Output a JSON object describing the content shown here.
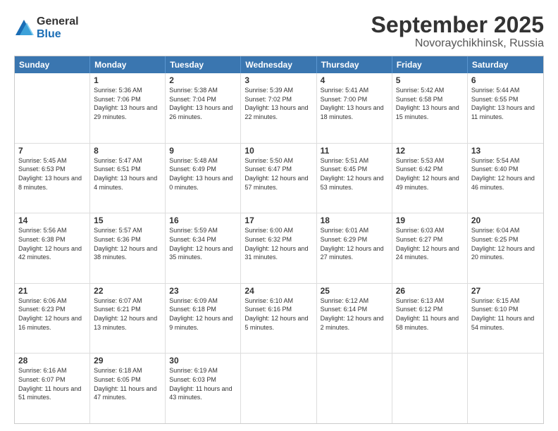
{
  "logo": {
    "general": "General",
    "blue": "Blue"
  },
  "header": {
    "month": "September 2025",
    "location": "Novoraychikhinsk, Russia"
  },
  "days": [
    "Sunday",
    "Monday",
    "Tuesday",
    "Wednesday",
    "Thursday",
    "Friday",
    "Saturday"
  ],
  "weeks": [
    [
      {
        "date": "",
        "sunrise": "",
        "sunset": "",
        "daylight": ""
      },
      {
        "date": "1",
        "sunrise": "Sunrise: 5:36 AM",
        "sunset": "Sunset: 7:06 PM",
        "daylight": "Daylight: 13 hours and 29 minutes."
      },
      {
        "date": "2",
        "sunrise": "Sunrise: 5:38 AM",
        "sunset": "Sunset: 7:04 PM",
        "daylight": "Daylight: 13 hours and 26 minutes."
      },
      {
        "date": "3",
        "sunrise": "Sunrise: 5:39 AM",
        "sunset": "Sunset: 7:02 PM",
        "daylight": "Daylight: 13 hours and 22 minutes."
      },
      {
        "date": "4",
        "sunrise": "Sunrise: 5:41 AM",
        "sunset": "Sunset: 7:00 PM",
        "daylight": "Daylight: 13 hours and 18 minutes."
      },
      {
        "date": "5",
        "sunrise": "Sunrise: 5:42 AM",
        "sunset": "Sunset: 6:58 PM",
        "daylight": "Daylight: 13 hours and 15 minutes."
      },
      {
        "date": "6",
        "sunrise": "Sunrise: 5:44 AM",
        "sunset": "Sunset: 6:55 PM",
        "daylight": "Daylight: 13 hours and 11 minutes."
      }
    ],
    [
      {
        "date": "7",
        "sunrise": "Sunrise: 5:45 AM",
        "sunset": "Sunset: 6:53 PM",
        "daylight": "Daylight: 13 hours and 8 minutes."
      },
      {
        "date": "8",
        "sunrise": "Sunrise: 5:47 AM",
        "sunset": "Sunset: 6:51 PM",
        "daylight": "Daylight: 13 hours and 4 minutes."
      },
      {
        "date": "9",
        "sunrise": "Sunrise: 5:48 AM",
        "sunset": "Sunset: 6:49 PM",
        "daylight": "Daylight: 13 hours and 0 minutes."
      },
      {
        "date": "10",
        "sunrise": "Sunrise: 5:50 AM",
        "sunset": "Sunset: 6:47 PM",
        "daylight": "Daylight: 12 hours and 57 minutes."
      },
      {
        "date": "11",
        "sunrise": "Sunrise: 5:51 AM",
        "sunset": "Sunset: 6:45 PM",
        "daylight": "Daylight: 12 hours and 53 minutes."
      },
      {
        "date": "12",
        "sunrise": "Sunrise: 5:53 AM",
        "sunset": "Sunset: 6:42 PM",
        "daylight": "Daylight: 12 hours and 49 minutes."
      },
      {
        "date": "13",
        "sunrise": "Sunrise: 5:54 AM",
        "sunset": "Sunset: 6:40 PM",
        "daylight": "Daylight: 12 hours and 46 minutes."
      }
    ],
    [
      {
        "date": "14",
        "sunrise": "Sunrise: 5:56 AM",
        "sunset": "Sunset: 6:38 PM",
        "daylight": "Daylight: 12 hours and 42 minutes."
      },
      {
        "date": "15",
        "sunrise": "Sunrise: 5:57 AM",
        "sunset": "Sunset: 6:36 PM",
        "daylight": "Daylight: 12 hours and 38 minutes."
      },
      {
        "date": "16",
        "sunrise": "Sunrise: 5:59 AM",
        "sunset": "Sunset: 6:34 PM",
        "daylight": "Daylight: 12 hours and 35 minutes."
      },
      {
        "date": "17",
        "sunrise": "Sunrise: 6:00 AM",
        "sunset": "Sunset: 6:32 PM",
        "daylight": "Daylight: 12 hours and 31 minutes."
      },
      {
        "date": "18",
        "sunrise": "Sunrise: 6:01 AM",
        "sunset": "Sunset: 6:29 PM",
        "daylight": "Daylight: 12 hours and 27 minutes."
      },
      {
        "date": "19",
        "sunrise": "Sunrise: 6:03 AM",
        "sunset": "Sunset: 6:27 PM",
        "daylight": "Daylight: 12 hours and 24 minutes."
      },
      {
        "date": "20",
        "sunrise": "Sunrise: 6:04 AM",
        "sunset": "Sunset: 6:25 PM",
        "daylight": "Daylight: 12 hours and 20 minutes."
      }
    ],
    [
      {
        "date": "21",
        "sunrise": "Sunrise: 6:06 AM",
        "sunset": "Sunset: 6:23 PM",
        "daylight": "Daylight: 12 hours and 16 minutes."
      },
      {
        "date": "22",
        "sunrise": "Sunrise: 6:07 AM",
        "sunset": "Sunset: 6:21 PM",
        "daylight": "Daylight: 12 hours and 13 minutes."
      },
      {
        "date": "23",
        "sunrise": "Sunrise: 6:09 AM",
        "sunset": "Sunset: 6:18 PM",
        "daylight": "Daylight: 12 hours and 9 minutes."
      },
      {
        "date": "24",
        "sunrise": "Sunrise: 6:10 AM",
        "sunset": "Sunset: 6:16 PM",
        "daylight": "Daylight: 12 hours and 5 minutes."
      },
      {
        "date": "25",
        "sunrise": "Sunrise: 6:12 AM",
        "sunset": "Sunset: 6:14 PM",
        "daylight": "Daylight: 12 hours and 2 minutes."
      },
      {
        "date": "26",
        "sunrise": "Sunrise: 6:13 AM",
        "sunset": "Sunset: 6:12 PM",
        "daylight": "Daylight: 11 hours and 58 minutes."
      },
      {
        "date": "27",
        "sunrise": "Sunrise: 6:15 AM",
        "sunset": "Sunset: 6:10 PM",
        "daylight": "Daylight: 11 hours and 54 minutes."
      }
    ],
    [
      {
        "date": "28",
        "sunrise": "Sunrise: 6:16 AM",
        "sunset": "Sunset: 6:07 PM",
        "daylight": "Daylight: 11 hours and 51 minutes."
      },
      {
        "date": "29",
        "sunrise": "Sunrise: 6:18 AM",
        "sunset": "Sunset: 6:05 PM",
        "daylight": "Daylight: 11 hours and 47 minutes."
      },
      {
        "date": "30",
        "sunrise": "Sunrise: 6:19 AM",
        "sunset": "Sunset: 6:03 PM",
        "daylight": "Daylight: 11 hours and 43 minutes."
      },
      {
        "date": "",
        "sunrise": "",
        "sunset": "",
        "daylight": ""
      },
      {
        "date": "",
        "sunrise": "",
        "sunset": "",
        "daylight": ""
      },
      {
        "date": "",
        "sunrise": "",
        "sunset": "",
        "daylight": ""
      },
      {
        "date": "",
        "sunrise": "",
        "sunset": "",
        "daylight": ""
      }
    ]
  ]
}
